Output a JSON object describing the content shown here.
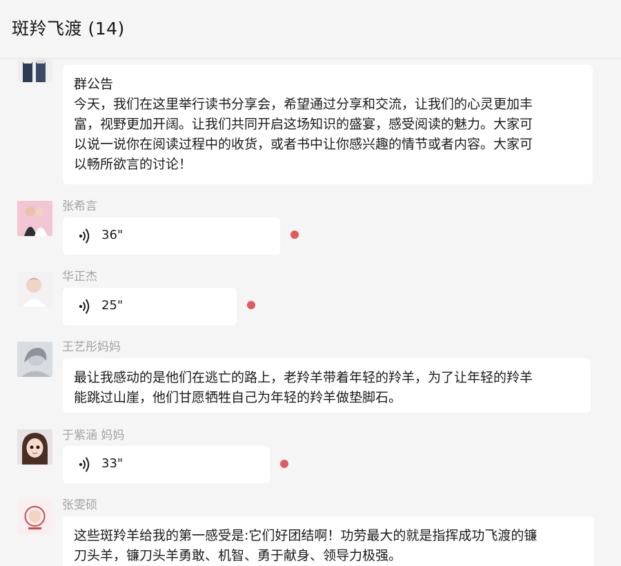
{
  "header": {
    "title": "斑羚飞渡 (14)"
  },
  "colors": {
    "unread_dot": "#e25a5a",
    "background": "#f5f5f5",
    "bubble": "#ffffff",
    "sender_name": "#a3a3a3"
  },
  "messages": [
    {
      "type": "text",
      "sender": "",
      "lines": [
        "群公告",
        "今天，我们在这里举行读书分享会，希望通过分享和交流，让我们的心灵更加丰",
        "富，视野更加开阔。让我们共同开启这场知识的盛宴，感受阅读的魅力。大家可",
        "以说一说你在阅读过程中的收货，或者书中让你感兴趣的情节或者内容。大家可",
        "以畅所欲言的讨论！"
      ]
    },
    {
      "type": "voice",
      "sender": "张希言",
      "duration": "36\"",
      "unread": true,
      "icon": "voice-wave-icon"
    },
    {
      "type": "voice",
      "sender": "华正杰",
      "duration": "25\"",
      "unread": true,
      "icon": "voice-wave-icon"
    },
    {
      "type": "text",
      "sender": "王艺彤妈妈",
      "lines": [
        "最让我感动的是他们在逃亡的路上，老羚羊带着年轻的羚羊，为了让年轻的羚羊",
        "能跳过山崖，他们甘愿牺牲自己为年轻的羚羊做垫脚石。"
      ]
    },
    {
      "type": "voice",
      "sender": "于紫涵 妈妈",
      "duration": "33\"",
      "unread": true,
      "icon": "voice-wave-icon"
    },
    {
      "type": "text",
      "sender": "张雯硕",
      "lines": [
        "这些斑羚羊给我的第一感受是:它们好团结啊！功劳最大的就是指挥成功飞渡的镰",
        "刀头羊，镰刀头羊勇敢、机智、勇于献身、领导力极强。"
      ]
    }
  ]
}
